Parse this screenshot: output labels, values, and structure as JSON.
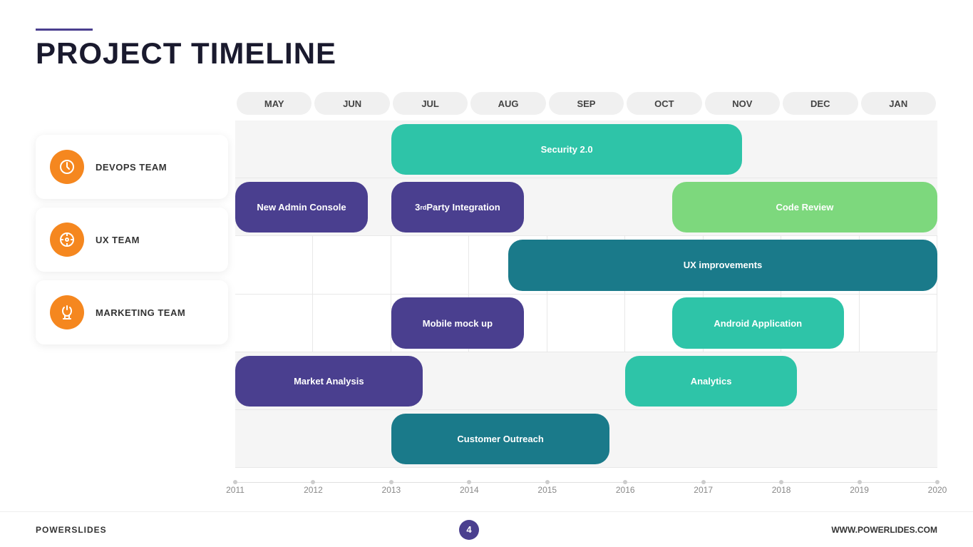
{
  "title": "PROJECT TIMELINE",
  "footer": {
    "brand": "POWERSLIDES",
    "page": "4",
    "url": "WWW.POWERLIDES.COM"
  },
  "months": [
    "MAY",
    "JUN",
    "JUL",
    "AUG",
    "SEP",
    "OCT",
    "NOV",
    "DEC",
    "JAN"
  ],
  "years": [
    "2011",
    "2012",
    "2013",
    "2014",
    "2015",
    "2016",
    "2017",
    "2018",
    "2019",
    "2020"
  ],
  "teams": [
    {
      "id": "devops",
      "label": "DEVOPS TEAM",
      "icon": "clock"
    },
    {
      "id": "ux",
      "label": "UX TEAM",
      "icon": "compass"
    },
    {
      "id": "marketing",
      "label": "MARKETING TEAM",
      "icon": "hourglass"
    }
  ],
  "bars": [
    {
      "label": "Security 2.0",
      "color": "#2ec4a8",
      "row": 0,
      "rowSpan": 1,
      "startCol": 2.0,
      "endCol": 6.5,
      "rowHeight": 0,
      "rowOffset": 0
    },
    {
      "label": "New Admin Console",
      "color": "#4a3f8f",
      "row": 0,
      "startCol": 0,
      "endCol": 1.7,
      "rowOffset": 1
    },
    {
      "label": "3rd Party Integration",
      "color": "#4a3f8f",
      "row": 0,
      "startCol": 2.0,
      "endCol": 3.7,
      "rowOffset": 1
    },
    {
      "label": "Code Review",
      "color": "#7dd87d",
      "row": 0,
      "startCol": 5.6,
      "endCol": 9.0,
      "rowOffset": 1
    },
    {
      "label": "UX improvements",
      "color": "#1a7a8a",
      "row": 1,
      "startCol": 3.5,
      "endCol": 9.0,
      "rowOffset": 0
    },
    {
      "label": "Mobile mock up",
      "color": "#4a3f8f",
      "row": 1,
      "startCol": 2.0,
      "endCol": 3.7,
      "rowOffset": 1
    },
    {
      "label": "Android Application",
      "color": "#2ec4a8",
      "row": 1,
      "startCol": 5.6,
      "endCol": 7.8,
      "rowOffset": 1
    },
    {
      "label": "Market Analysis",
      "color": "#4a3f8f",
      "row": 2,
      "startCol": 0,
      "endCol": 2.4,
      "rowOffset": 0
    },
    {
      "label": "Analytics",
      "color": "#2ec4a8",
      "row": 2,
      "startCol": 5.0,
      "endCol": 7.2,
      "rowOffset": 0
    },
    {
      "label": "Customer Outreach",
      "color": "#1a7a8a",
      "row": 2,
      "startCol": 2.0,
      "endCol": 4.8,
      "rowOffset": 1
    }
  ]
}
